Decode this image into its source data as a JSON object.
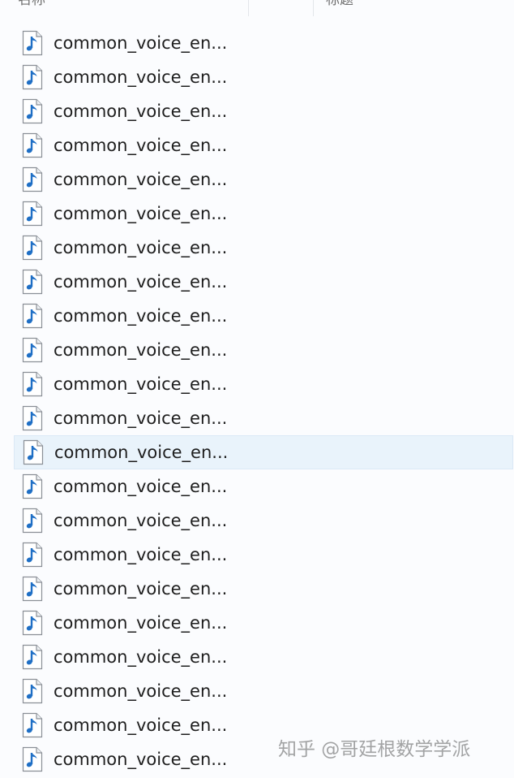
{
  "header": {
    "col1_label": "名称",
    "col2_label": "标题"
  },
  "file_icon": "audio-file-icon",
  "files": [
    {
      "name": "common_voice_en..."
    },
    {
      "name": "common_voice_en..."
    },
    {
      "name": "common_voice_en..."
    },
    {
      "name": "common_voice_en..."
    },
    {
      "name": "common_voice_en..."
    },
    {
      "name": "common_voice_en..."
    },
    {
      "name": "common_voice_en..."
    },
    {
      "name": "common_voice_en..."
    },
    {
      "name": "common_voice_en..."
    },
    {
      "name": "common_voice_en..."
    },
    {
      "name": "common_voice_en..."
    },
    {
      "name": "common_voice_en..."
    },
    {
      "name": "common_voice_en...",
      "selected": true
    },
    {
      "name": "common_voice_en..."
    },
    {
      "name": "common_voice_en..."
    },
    {
      "name": "common_voice_en..."
    },
    {
      "name": "common_voice_en..."
    },
    {
      "name": "common_voice_en..."
    },
    {
      "name": "common_voice_en..."
    },
    {
      "name": "common_voice_en..."
    },
    {
      "name": "common_voice_en..."
    },
    {
      "name": "common_voice_en..."
    }
  ],
  "watermark": "知乎 @哥廷根数学学派",
  "colors": {
    "selection_bg": "#e9f3fb",
    "icon_blue": "#1f6fc5"
  }
}
